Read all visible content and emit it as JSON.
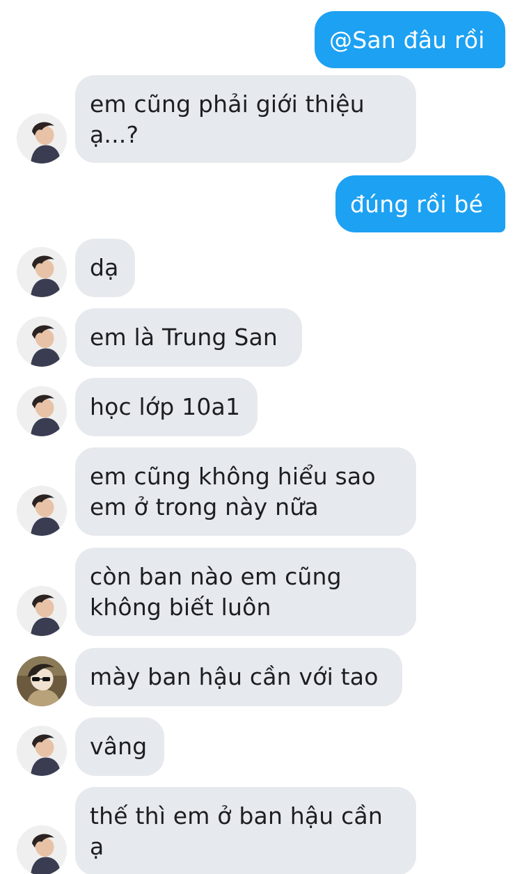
{
  "conversation": {
    "messages": [
      {
        "sender": "me",
        "text": "@San đâu rồi"
      },
      {
        "sender": "trung-san",
        "text": "em cũng phải giới thiệu\nạ...?"
      },
      {
        "sender": "me",
        "text": "đúng rồi bé"
      },
      {
        "sender": "trung-san",
        "text": "dạ"
      },
      {
        "sender": "trung-san",
        "text": "em là Trung San"
      },
      {
        "sender": "trung-san",
        "text": "học lớp 10a1"
      },
      {
        "sender": "trung-san",
        "text": "em cũng không hiểu sao\nem ở trong này nữa"
      },
      {
        "sender": "trung-san",
        "text": "còn ban nào em cũng\nkhông biết luôn"
      },
      {
        "sender": "other-user",
        "text": "mày ban hậu cần với tao"
      },
      {
        "sender": "trung-san",
        "text": "vâng"
      },
      {
        "sender": "trung-san",
        "text": "thế thì em ở ban hậu cần\nạ"
      }
    ]
  },
  "colors": {
    "outgoing_bubble": "#1da1f2",
    "incoming_bubble": "#e6e9ed",
    "outgoing_text": "#ffffff",
    "incoming_text": "#1c1e21"
  },
  "avatars": {
    "trung-san": "portrait-avatar-dark-hair",
    "other-user": "portrait-avatar-sunglasses"
  }
}
